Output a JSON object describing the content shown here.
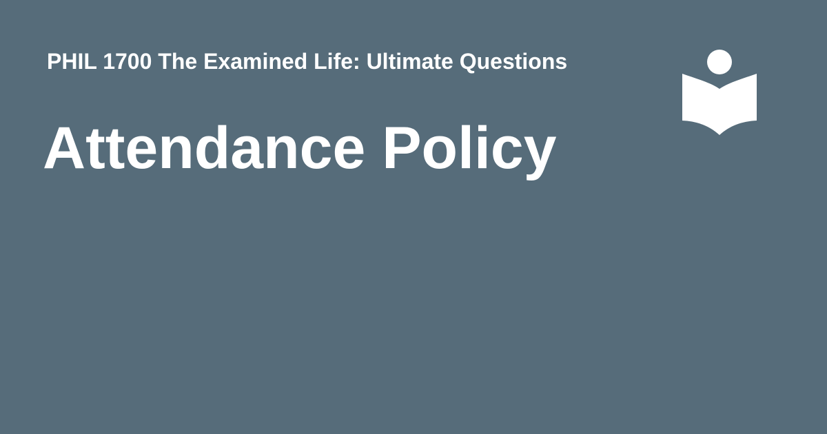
{
  "header": {
    "course_title": "PHIL 1700 The Examined Life: Ultimate Questions",
    "page_title": "Attendance Policy"
  },
  "logo": {
    "icon": "reader-book-icon"
  },
  "colors": {
    "background": "#566c7a",
    "text": "#ffffff",
    "logo": "#ffffff"
  }
}
